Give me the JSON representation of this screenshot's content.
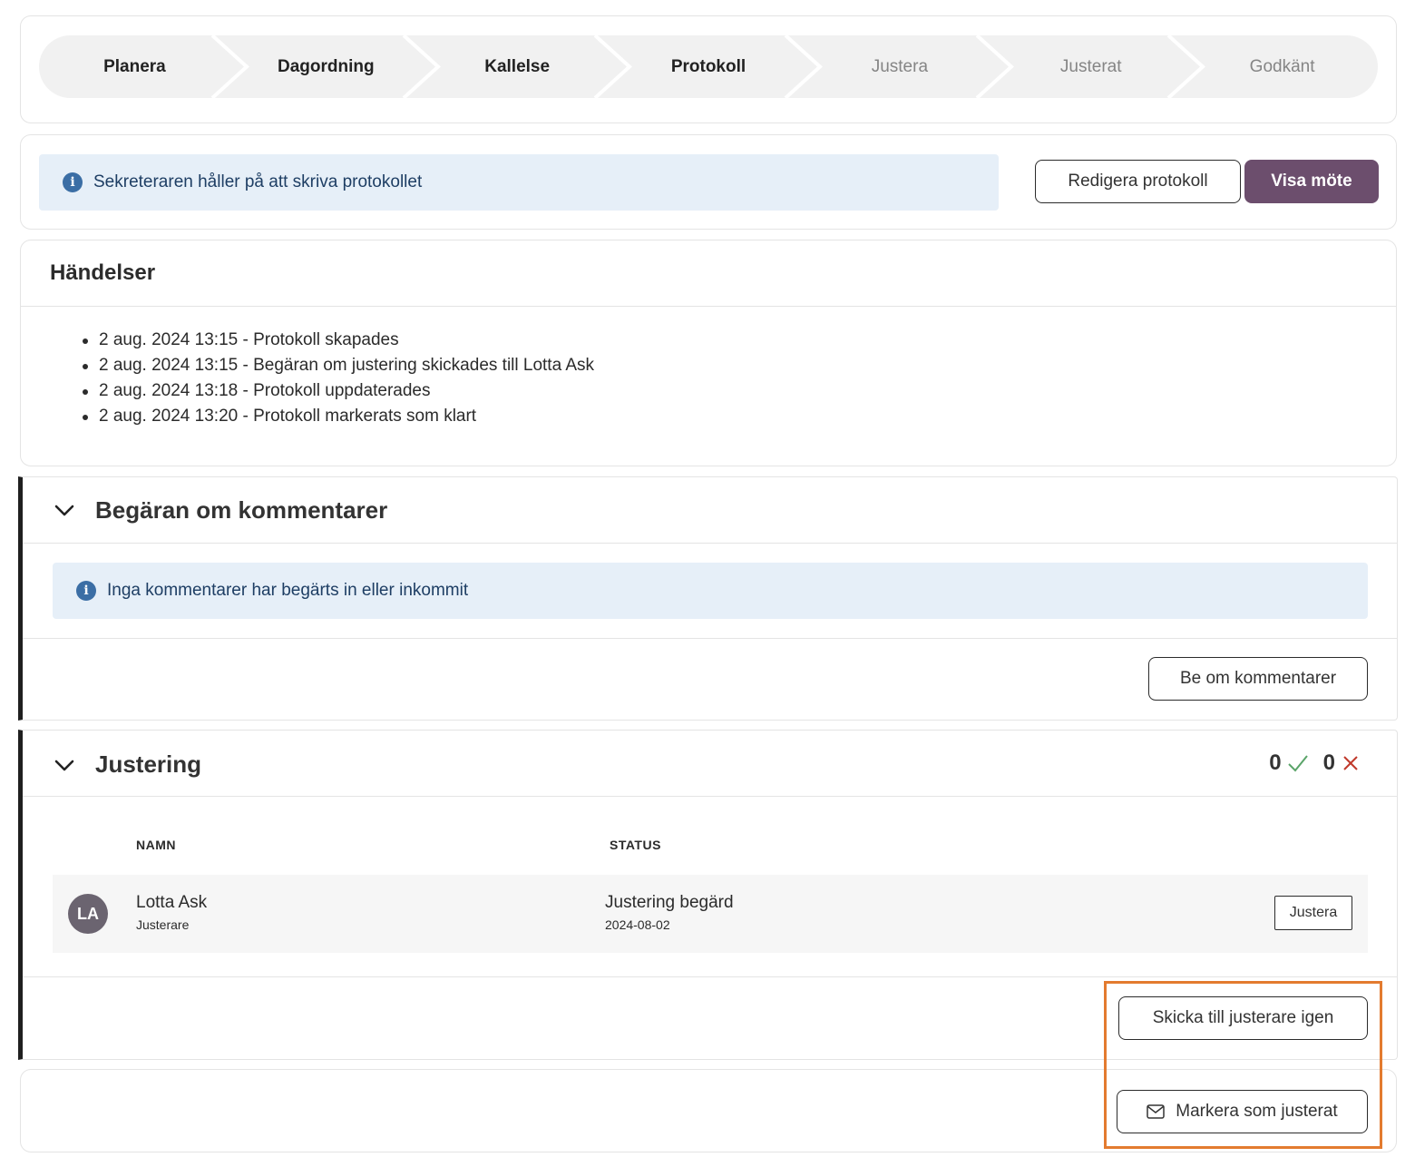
{
  "stepper": {
    "steps": [
      {
        "label": "Planera",
        "state": "done"
      },
      {
        "label": "Dagordning",
        "state": "done"
      },
      {
        "label": "Kallelse",
        "state": "done"
      },
      {
        "label": "Protokoll",
        "state": "current"
      },
      {
        "label": "Justera",
        "state": "pending"
      },
      {
        "label": "Justerat",
        "state": "pending"
      },
      {
        "label": "Godkänt",
        "state": "pending"
      }
    ]
  },
  "status": {
    "info_text": "Sekreteraren håller på att skriva protokollet",
    "edit_button": "Redigera protokoll",
    "show_button": "Visa möte"
  },
  "events": {
    "title": "Händelser",
    "items": [
      "2 aug. 2024 13:15 - Protokoll skapades",
      "2 aug. 2024 13:15 - Begäran om justering skickades till Lotta Ask",
      "2 aug. 2024 13:18 - Protokoll uppdaterades",
      "2 aug. 2024 13:20 - Protokoll markerats som klart"
    ]
  },
  "comments": {
    "title": "Begäran om kommentarer",
    "info_text": "Inga kommentarer har begärts in eller inkommit",
    "request_button": "Be om kommentarer"
  },
  "justering": {
    "title": "Justering",
    "approved_count": "0",
    "rejected_count": "0",
    "columns": {
      "name": "NAMN",
      "status": "STATUS"
    },
    "rows": [
      {
        "initials": "LA",
        "name": "Lotta Ask",
        "role": "Justerare",
        "status": "Justering begärd",
        "date": "2024-08-02",
        "action": "Justera"
      }
    ],
    "resend_button": "Skicka till justerare igen"
  },
  "footer": {
    "mark_button": "Markera som justerat"
  },
  "colors": {
    "primary": "#6c4e6d",
    "info_bg": "#e6eff8",
    "check": "#5aa469",
    "cross": "#c0392b",
    "highlight": "#e37b2f"
  }
}
